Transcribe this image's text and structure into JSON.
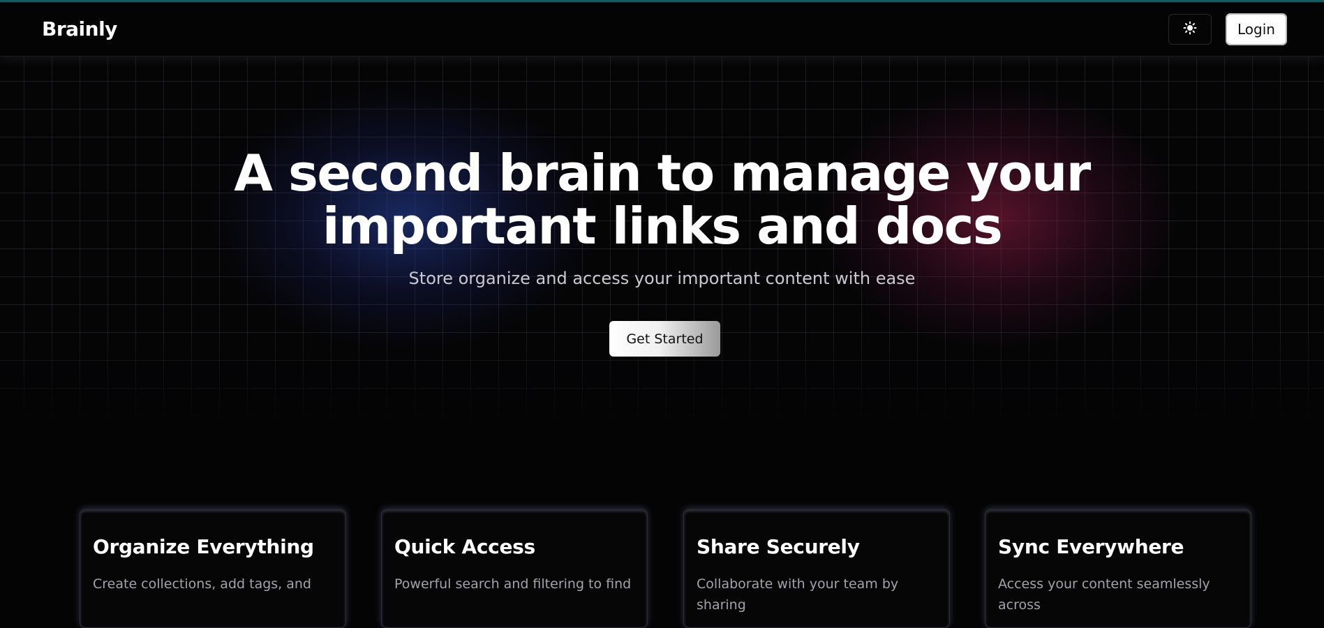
{
  "header": {
    "brand": "Brainly",
    "theme_icon": "sun-icon",
    "login_label": "Login"
  },
  "hero": {
    "title_line1": "A second brain to manage your",
    "title_line2": "important links and docs",
    "subtitle": "Store organize and access your important content with ease",
    "cta_label": "Get Started"
  },
  "features": [
    {
      "title": "Organize Everything",
      "description": "Create collections, add tags, and"
    },
    {
      "title": "Quick Access",
      "description": "Powerful search and filtering to find"
    },
    {
      "title": "Share Securely",
      "description": "Collaborate with your team by sharing"
    },
    {
      "title": "Sync Everywhere",
      "description": "Access your content seamlessly across"
    }
  ],
  "colors": {
    "background": "#040405",
    "accent_top": "#0f5c66",
    "glow_blue": "#2846aa",
    "glow_red": "#961e46"
  }
}
